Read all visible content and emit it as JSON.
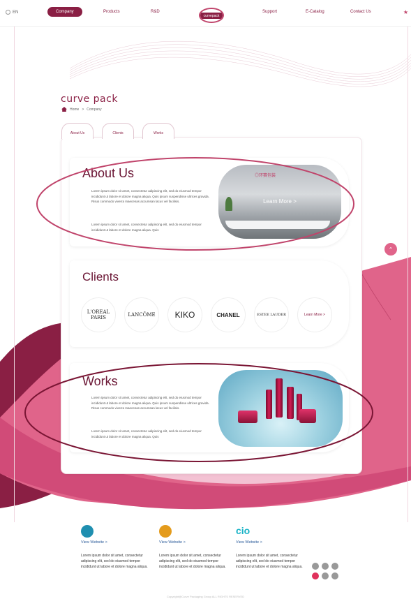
{
  "nav": {
    "lang": "EN",
    "items": [
      "Company",
      "Products",
      "R&D",
      "Support",
      "E-Catalog",
      "Contact Us"
    ],
    "logo_text": "curvepack",
    "star_icon": "star-icon"
  },
  "brand": "curve pack",
  "breadcrumb": {
    "home": "Home",
    "sep": ">",
    "current": "Company"
  },
  "tabs": [
    "About Us",
    "Clients",
    "Works"
  ],
  "about": {
    "title": "About Us",
    "p1": "Lorem ipsum dolor sit amet, consectetur adipiscing elit, sed do eiusmod tempor incididunt ut labore et dolore magna aliqua. Quis ipsum suspendisse ultrices gravida. Risus commodo viverra maecenas accumsan lacus vel facilisis.",
    "p2": "Lorem ipsum dolor sit amet, consectetur adipiscing elit, sed do eiusmod tempor incididunt ut labore et dolore magna aliqua. Quis",
    "learn_more": "Learn More  >",
    "sign_text": "◎环赛包装"
  },
  "clients": {
    "title": "Clients",
    "logos": [
      "L'OREAL PARIS",
      "LANCÔME",
      "KIKO",
      "CHANEL",
      "ESTEE LAUDER"
    ],
    "learn_more": "Learn More  >"
  },
  "works": {
    "title": "Works",
    "p1": "Lorem ipsum dolor sit amet, consectetur adipiscing elit, sed do eiusmod tempor incididunt ut labore et dolore magna aliqua. Quis ipsum suspendisse ultrices gravida. Risus commodo viverra maecenas accumsan lacus vel facilisis.",
    "p2": "Lorem ipsum dolor sit amet, consectetur adipiscing elit, sed do eiusmod tempor incididunt ut labore et dolore magna aliqua. Quis"
  },
  "footer": {
    "columns": [
      {
        "link": "View Website  >",
        "text": "Lorem ipsum dolor sit amet, consectetur adipiscing elit, sed do eiusmod tempor incididunt ut labore et dolore magna aliqua.",
        "color": "#1f8fb0"
      },
      {
        "link": "View Website  >",
        "text": "Lorem ipsum dolor sit amet, consectetur adipiscing elit, sed do eiusmod tempor incididunt ut labore et dolore magna aliqua.",
        "color": "#e49b1c"
      },
      {
        "link": "View Website  >",
        "text": "Lorem ipsum dolor sit amet, consectetur adipiscing elit, sed do eiusmod tempor incididunt ut labore et dolore magna aliqua.",
        "color": "#1ab3c7"
      }
    ],
    "third_logo": "cio",
    "copyright": "Copyright@Curve Packaging Group ALL RIGHTS RESERVED"
  },
  "colors": {
    "primary": "#8a1f44",
    "accent": "#e0648a",
    "light_pink": "#f3c2d3"
  }
}
